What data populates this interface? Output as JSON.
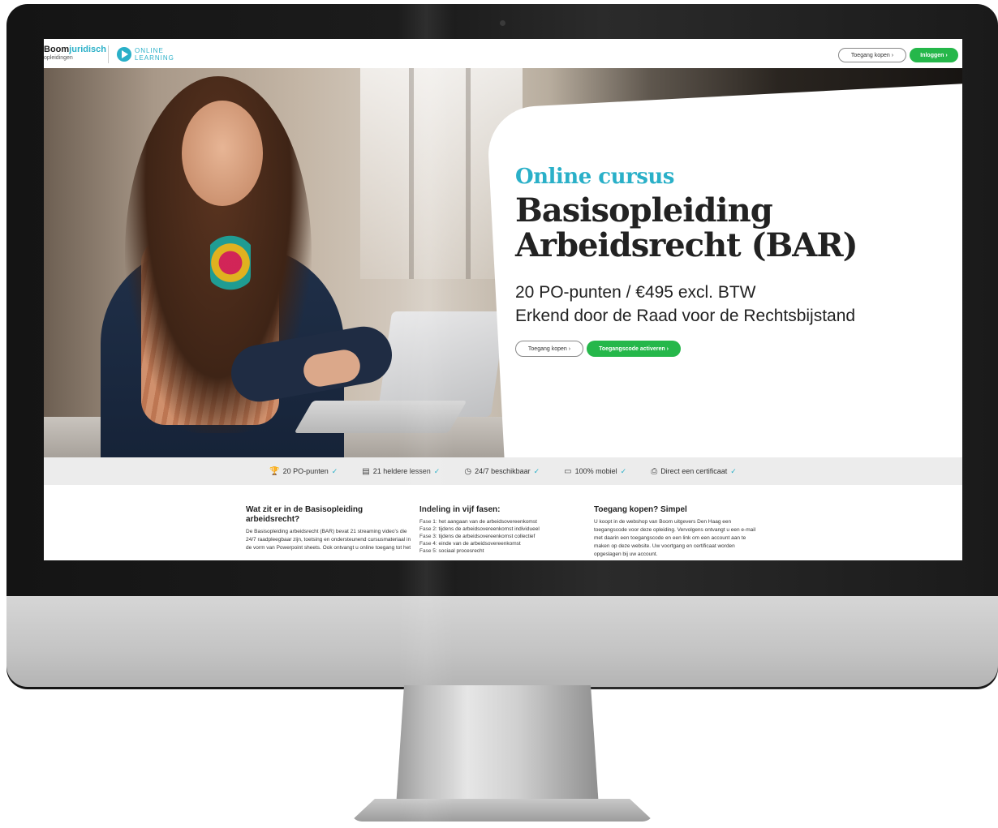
{
  "header": {
    "logo_boom": "Boom",
    "logo_juridisch": "juridisch",
    "logo_sub": "opleidingen",
    "online_line1": "ONLINE",
    "online_line2": "LEARNING",
    "buy_label": "Toegang kopen",
    "login_label": "Inloggen"
  },
  "hero": {
    "kicker": "Online cursus",
    "title_line1": "Basisopleiding",
    "title_line2": "Arbeidsrecht (BAR)",
    "sub1": "20 PO-punten / €495 excl. BTW",
    "sub2": "Erkend door de Raad voor de Rechtsbijstand",
    "buy_label": "Toegang kopen",
    "activate_label": "Toegangscode activeren"
  },
  "features": [
    {
      "icon": "trophy-icon",
      "glyph": "🏆",
      "label": "20 PO-punten"
    },
    {
      "icon": "lessons-icon",
      "glyph": "▤",
      "label": "21 heldere lessen"
    },
    {
      "icon": "clock-icon",
      "glyph": "◷",
      "label": "24/7 beschikbaar"
    },
    {
      "icon": "devices-icon",
      "glyph": "▭",
      "label": "100% mobiel"
    },
    {
      "icon": "certificate-icon",
      "glyph": "⎙",
      "label": "Direct een certificaat"
    }
  ],
  "content": {
    "col1_title": "Wat zit er in de Basisopleiding arbeidsrecht?",
    "col1_text": "De Basisopleiding arbeidsrecht (BAR) bevat 21 streaming video's die 24/7 raadpleegbaar zijn, toetsing en ondersteunend cursusmateriaal in de vorm van Powerpoint sheets. Ook ontvangt u online toegang tot het",
    "col2_title": "Indeling in vijf fasen:",
    "col2_items": [
      "Fase 1: het aangaan van de arbeidsovereenkomst",
      "Fase 2: tijdens de arbeidsovereenkomst individueel",
      "Fase 3: tijdens de arbeidsovereenkomst collectief",
      "Fase 4: einde van de arbeidsovereenkomst",
      "Fase 5: sociaal procesrecht"
    ],
    "col3_title": "Toegang kopen? Simpel",
    "col3_text": "U koopt in de webshop van Boom uitgevers Den Haag een toegangscode voor deze opleiding. Vervolgens ontvangt u een e-mail met daarin een toegangscode en een link om een account aan te maken op deze website. Uw voortgang en certificaat worden opgeslagen bij uw account."
  },
  "colors": {
    "accent": "#2ab0c8",
    "green": "#25b74a"
  }
}
